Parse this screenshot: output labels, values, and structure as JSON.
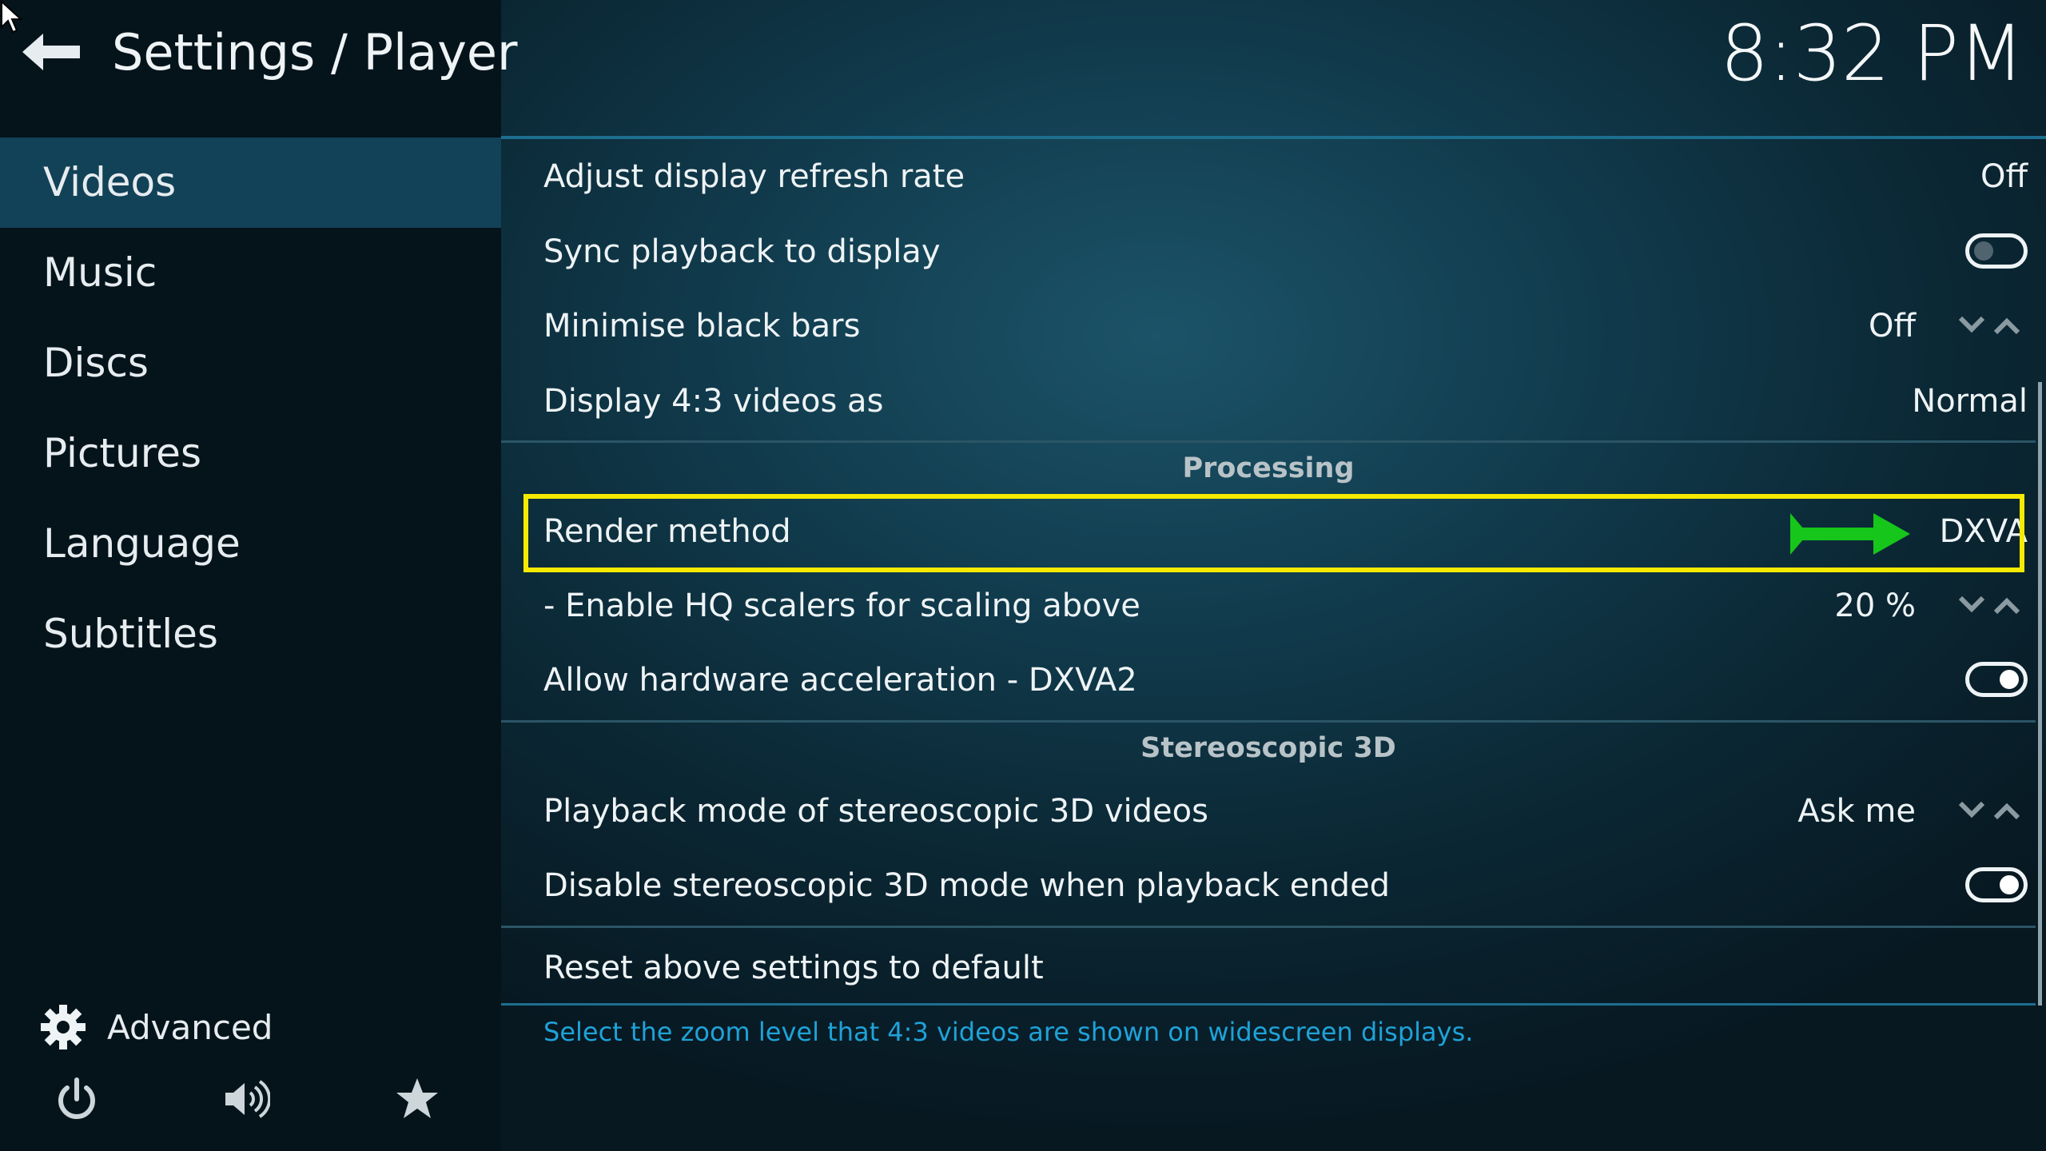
{
  "header": {
    "title": "Settings / Player",
    "clock": "8:32 PM"
  },
  "sidebar": {
    "items": [
      {
        "label": "Videos",
        "active": true
      },
      {
        "label": "Music",
        "active": false
      },
      {
        "label": "Discs",
        "active": false
      },
      {
        "label": "Pictures",
        "active": false
      },
      {
        "label": "Language",
        "active": false
      },
      {
        "label": "Subtitles",
        "active": false
      }
    ],
    "advanced_label": "Advanced",
    "bottom_icons": [
      "power-icon",
      "volume-icon",
      "favourites-star-icon"
    ]
  },
  "settings": {
    "adjust_refresh": {
      "label": "Adjust display refresh rate",
      "value": "Off"
    },
    "sync_playback": {
      "label": "Sync playback to display",
      "toggle": false
    },
    "minimise_bars": {
      "label": "Minimise black bars",
      "value": "Off"
    },
    "display_43": {
      "label": "Display 4:3 videos as",
      "value": "Normal"
    },
    "section_processing": "Processing",
    "render_method": {
      "label": "Render method",
      "value": "DXVA"
    },
    "hq_scalers": {
      "label": "- Enable HQ scalers for scaling above",
      "value": "20 %"
    },
    "hw_accel": {
      "label": "Allow hardware acceleration - DXVA2",
      "toggle": true
    },
    "section_stereo": "Stereoscopic 3D",
    "stereo_mode": {
      "label": "Playback mode of stereoscopic 3D videos",
      "value": "Ask me"
    },
    "disable_stereo": {
      "label": "Disable stereoscopic 3D mode when playback ended",
      "toggle": true
    },
    "reset": {
      "label": "Reset above settings to default"
    }
  },
  "help_text": "Select the zoom level that 4:3 videos are shown on widescreen displays.",
  "colors": {
    "highlight_border": "#f5ea00",
    "annotation_arrow": "#16c61a",
    "help_text": "#1fa2d8",
    "active_nav": "#124257"
  }
}
